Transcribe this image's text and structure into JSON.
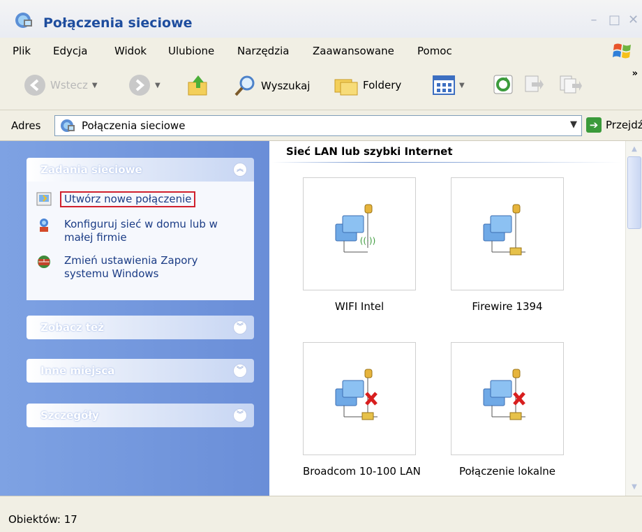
{
  "window": {
    "title": "Połączenia sieciowe",
    "controls": [
      "minimize",
      "maximize",
      "close"
    ]
  },
  "menu": {
    "items": [
      "Plik",
      "Edycja",
      "Widok",
      "Ulubione",
      "Narzędzia",
      "Zaawansowane",
      "Pomoc"
    ]
  },
  "toolbar": {
    "back_label": "Wstecz",
    "search_label": "Wyszukaj",
    "folders_label": "Foldery",
    "more": "»"
  },
  "address": {
    "label": "Adres",
    "value": "Połączenia sieciowe",
    "go_label": "Przejdź"
  },
  "sidebar": {
    "groups": [
      {
        "title": "Zadania sieciowe",
        "expanded": true,
        "tasks": [
          {
            "label": "Utwórz nowe połączenie",
            "icon": "new-connection-icon"
          },
          {
            "label": "Konfiguruj sieć w domu lub w małej firmie",
            "label_lines": [
              "Konfiguruj sieć w domu lub w",
              "małej firmie"
            ],
            "icon": "home-network-wizard-icon"
          },
          {
            "label": "Zmień ustawienia Zapory systemu Windows",
            "label_lines": [
              "Zmień ustawienia Zapory",
              "systemu Windows"
            ],
            "icon": "firewall-icon"
          }
        ]
      },
      {
        "title": "Zobacz też",
        "expanded": false
      },
      {
        "title": "Inne miejsca",
        "expanded": false
      },
      {
        "title": "Szczegóły",
        "expanded": false
      }
    ]
  },
  "content": {
    "section_title": "Sieć LAN lub szybki Internet",
    "connections": [
      {
        "label": "WIFI Intel",
        "type": "wireless",
        "status": "connected"
      },
      {
        "label": "Firewire 1394",
        "type": "wired",
        "status": "connected"
      },
      {
        "label": "Broadcom 10-100 LAN",
        "type": "wired",
        "status": "disconnected"
      },
      {
        "label": "Połączenie lokalne",
        "type": "wired",
        "status": "disconnected"
      }
    ]
  },
  "status": {
    "text": "Obiektów: 17"
  },
  "colors": {
    "task_pane": "#7ea2e3",
    "link": "#1b3c85",
    "highlight_border": "#d0202c",
    "title_text": "#1e4d9e"
  }
}
